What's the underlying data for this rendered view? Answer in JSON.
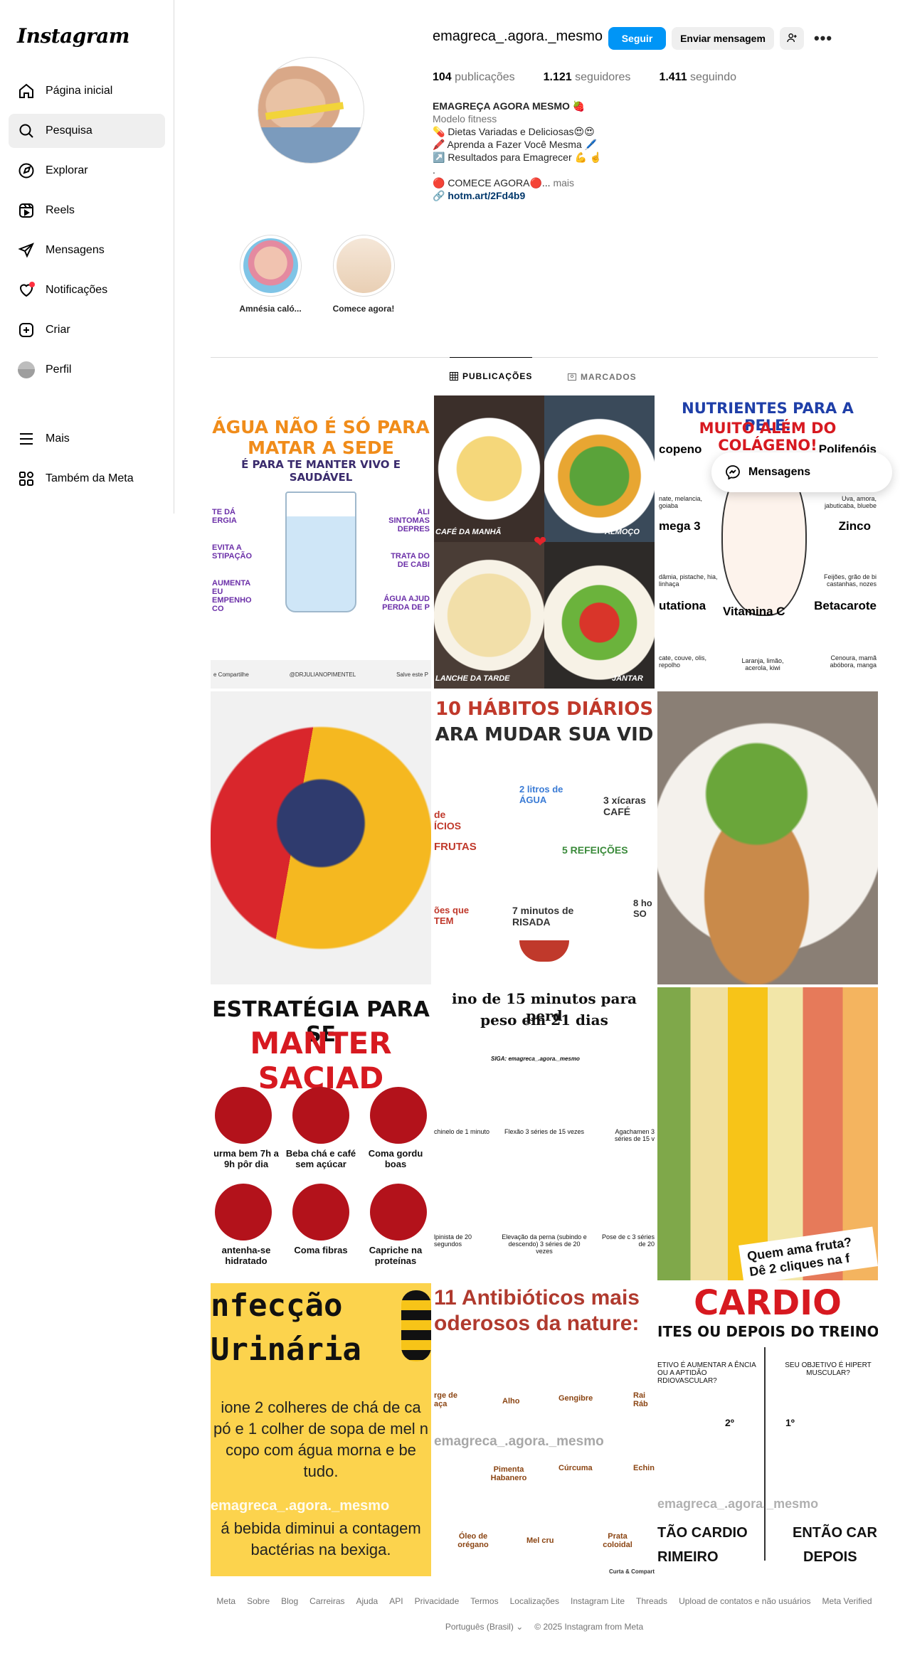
{
  "sidebar": {
    "logo": "Instagram",
    "items": [
      {
        "label": "Página inicial",
        "icon": "home-icon"
      },
      {
        "label": "Pesquisa",
        "icon": "search-icon"
      },
      {
        "label": "Explorar",
        "icon": "explore-icon"
      },
      {
        "label": "Reels",
        "icon": "reels-icon"
      },
      {
        "label": "Mensagens",
        "icon": "messages-icon"
      },
      {
        "label": "Notificações",
        "icon": "heart-icon"
      },
      {
        "label": "Criar",
        "icon": "plus-icon"
      },
      {
        "label": "Perfil",
        "icon": "avatar"
      },
      {
        "label": "Mais",
        "icon": "menu-icon"
      },
      {
        "label": "Também da Meta",
        "icon": "meta-apps-icon"
      }
    ]
  },
  "profile": {
    "username": "emagreca_.agora._mesmo",
    "follow_label": "Seguir",
    "message_label": "Enviar mensagem",
    "posts_count": "104",
    "posts_label": "publicações",
    "followers_count": "1.121",
    "followers_label": "seguidores",
    "following_count": "1.411",
    "following_label": "seguindo",
    "bio": {
      "name": "EMAGREÇA AGORA MESMO 🍓",
      "category": "Modelo fitness",
      "line1": "💊 Dietas Variadas e Deliciosas😍😍",
      "line2": "🖍️ Aprenda a Fazer Você Mesma 🖊️",
      "line3": "↗️ Resultados para Emagrecer 💪 ☝️",
      "line4": ".",
      "line5": "🔴 COMECE AGORA🔴...",
      "more": "mais",
      "link": "hotm.art/2Fd4b9"
    }
  },
  "highlights": [
    {
      "label": "Amnésia caló..."
    },
    {
      "label": "Comece agora!"
    }
  ],
  "tabs": {
    "posts": "PUBLICAÇÕES",
    "tagged": "MARCADOS"
  },
  "posts": [
    {
      "title": "ÁGUA NÃO É SÓ PARA MATAR A SEDE",
      "subtitle": "É PARA TE MANTER VIVO E SAUDÁVEL",
      "handle": "@DRJULIANOPIMENTEL",
      "left1": "TE DÁ ERGIA",
      "left2": "EVITA A STIPAÇÃO",
      "left3": "AUMENTA EU EMPENHO CO",
      "right1": "ALI SINTOMAS DEPRES",
      "right2": "TRATA DO DE CABI",
      "right3": "ÁGUA AJUD PERDA DE P",
      "foot1": "e Compartilhe",
      "foot2": "Salve este P"
    },
    {
      "q1": "CAFÉ DA MANHÃ",
      "q2": "ALMOÇO",
      "q3": "LANCHE DA TARDE",
      "q4": "JANTAR"
    },
    {
      "title1": "NUTRIENTES PARA A PELE:",
      "title2": "MUITO ALÉM DO COLÁGENO!",
      "n1": "copeno",
      "n2": "Polifenóis",
      "n3": "mega 3",
      "n4": "Zinco",
      "n5": "utationa",
      "n6": "Vitamina C",
      "n7": "Betacarote",
      "d1": "nate, melancia, goiaba",
      "d2": "Uva, amora, jabuticaba, bluebe",
      "d3": "dâmia, pistache, hia, linhaça",
      "d4": "Feijões, grão de bi castanhas, nozes",
      "d5": "cate, couve, olis, repolho",
      "d6": "Laranja, limão, acerola, kiwi",
      "d7": "Cenoura, mamã abóbora, manga"
    },
    {},
    {
      "title1": "10 HÁBITOS DIÁRIOS",
      "title2": "ARA MUDAR SUA VID",
      "h1": "2 litros de ÁGUA",
      "h2": "3 xícaras CAFÉ",
      "h3": "de ÍCIOS",
      "h4": "FRUTAS",
      "h5": "5 REFEIÇÕES",
      "h6": "ões que TEM",
      "h7": "7 minutos de RISADA",
      "h8": "8 ho SO"
    },
    {},
    {
      "title1": "ESTRATÉGIA PARA SE",
      "title2": "MANTER SACIAD",
      "i1": "urma bem 7h a 9h pôr dia",
      "i2": "Beba chá e café sem açúcar",
      "i3": "Coma gordu boas",
      "i4": "antenha-se hidratado",
      "i5": "Coma fibras",
      "i6": "Capriche na proteínas"
    },
    {
      "title1": "ino de 15 minutos para perd",
      "title2": "peso em 21 dias",
      "siga": "SIGA: emagreca_.agora._mesmo",
      "e1": "chinelo de 1 minuto",
      "e2": "Flexão 3 séries de 15 vezes",
      "e3": "Agachamen 3 séries de 15 v",
      "e4": "lpinista de 20 segundos",
      "e5": "Elevação da perna (subindo e descendo) 3 séries de 20 vezes",
      "e6": "Pose de c 3 séries de 20"
    },
    {
      "caption1": "Quem ama fruta?",
      "caption2": "Dê 2 cliques na f"
    },
    {
      "title1": "nfecção",
      "title2": "Urinária",
      "body": "ione 2 colheres de chá de ca pó e 1 colher de sopa de mel n copo com água morna e be tudo.",
      "watermark": "emagreca_.agora._mesmo",
      "body2": "á bebida diminui a contagem bactérias na bexiga."
    },
    {
      "title1": "11 Antibióticos mais",
      "title2": "oderosos da nature:",
      "a1": "Alho",
      "a2": "Gengibre",
      "a3": "rge de aça",
      "a4": "Rai Ráb",
      "a5": "Pimenta Habanero",
      "a6": "Cúrcuma",
      "a7": "Echin",
      "a8": "Óleo de orégano",
      "a9": "Mel cru",
      "a10": "Prata coloidal",
      "watermark": "emagreca_.agora._mesmo",
      "foot": "Curta & Compart"
    },
    {
      "title1": "CARDIO",
      "title2": "ITES OU DEPOIS DO TREINO",
      "q1": "ETIVO É AUMENTAR A ÊNCIA OU A APTIDÃO RDIOVASCULAR?",
      "q2": "SEU OBJETIVO É HIPERT MUSCULAR?",
      "n1": "2º",
      "n2": "1º",
      "watermark": "emagreca_.agora._mesmo",
      "a1": "TÃO CARDIO",
      "a2": "RIMEIRO",
      "b1": "ENTÃO CARD",
      "b2": "DEPOIS"
    }
  ],
  "messages_popup": {
    "label": "Mensagens"
  },
  "footer": {
    "links": [
      "Meta",
      "Sobre",
      "Blog",
      "Carreiras",
      "Ajuda",
      "API",
      "Privacidade",
      "Termos",
      "Localizações",
      "Instagram Lite",
      "Threads",
      "Upload de contatos e não usuários",
      "Meta Verified"
    ],
    "language": "Português (Brasil)",
    "copyright": "© 2025 Instagram from Meta"
  },
  "colors": {
    "accent": "#0095f6",
    "link": "#00376b",
    "notification": "#ff3040"
  }
}
